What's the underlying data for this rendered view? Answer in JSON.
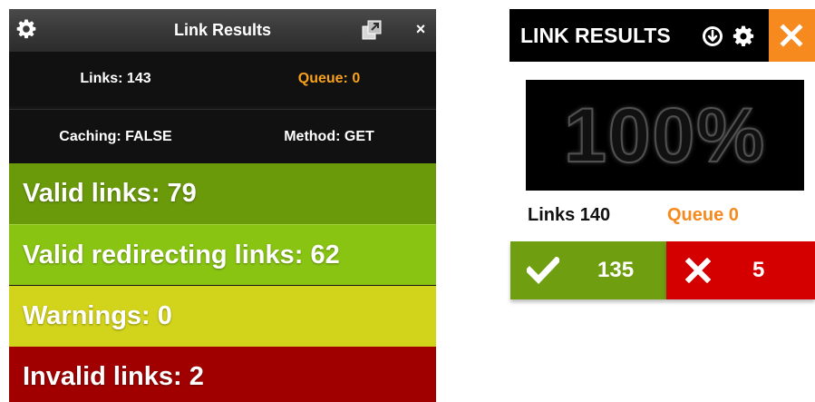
{
  "left_panel": {
    "title": "Link Results",
    "links": "Links: 143",
    "queue": "Queue: 0",
    "caching": "Caching: FALSE",
    "method": "Method: GET",
    "close_glyph": "×",
    "results": {
      "valid": "Valid links: 79",
      "redirecting": "Valid redirecting links: 62",
      "warnings": "Warnings: 0",
      "invalid": "Invalid links: 2"
    },
    "icons": [
      "gear-icon",
      "popout-icon",
      "close-icon"
    ]
  },
  "right_widget": {
    "title": "LINK RESULTS",
    "progress": "100%",
    "progress_value": 1.0,
    "links": "Links 140",
    "queue": "Queue 0",
    "valid_count": "135",
    "invalid_count": "5",
    "icons": [
      "download-icon",
      "gear-icon",
      "close-icon",
      "checkmark-icon",
      "x-icon"
    ]
  },
  "colors": {
    "valid_green": "#6a9a0a",
    "redirect_green": "#89c413",
    "warning_yellow": "#d2d31b",
    "invalid_red": "#a10000",
    "accent_orange": "#f68a1e",
    "bar_red": "#d40000"
  }
}
